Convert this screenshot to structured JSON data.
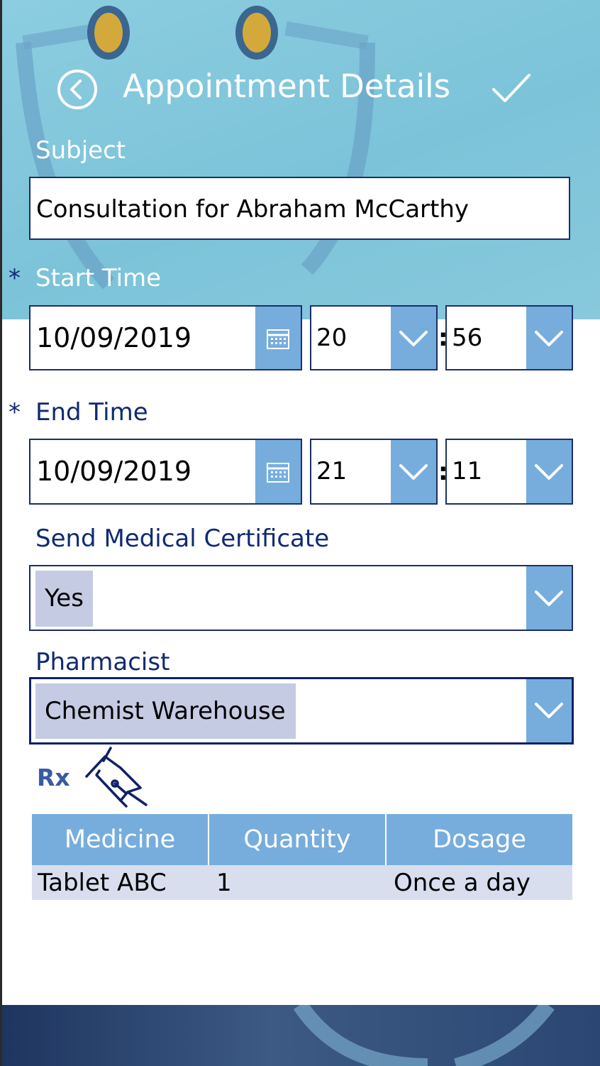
{
  "header": {
    "title": "Appointment Details",
    "back_icon": "back-circle-icon",
    "confirm_icon": "checkmark-icon"
  },
  "subject": {
    "label": "Subject",
    "value": "Consultation for Abraham McCarthy"
  },
  "start_time": {
    "required_marker": "*",
    "label": "Start Time",
    "date": "10/09/2019",
    "hour": "20",
    "minute": "56",
    "separator": ":"
  },
  "end_time": {
    "required_marker": "*",
    "label": "End Time",
    "date": "10/09/2019",
    "hour": "21",
    "minute": "11",
    "separator": ":"
  },
  "medical_certificate": {
    "label": "Send Medical Certificate",
    "selected": "Yes"
  },
  "pharmacist": {
    "label": "Pharmacist",
    "selected": "Chemist Warehouse"
  },
  "prescription": {
    "label": "Rx",
    "pen_icon": "fountain-pen-icon",
    "columns": [
      "Medicine",
      "Quantity",
      "Dosage"
    ],
    "rows": [
      {
        "medicine": "Tablet ABC",
        "quantity": "1",
        "dosage": "Once a day"
      }
    ]
  },
  "colors": {
    "accent": "#76addd",
    "navy": "#102a72",
    "chip": "#c4cbe2",
    "footer": "#1e3560"
  }
}
